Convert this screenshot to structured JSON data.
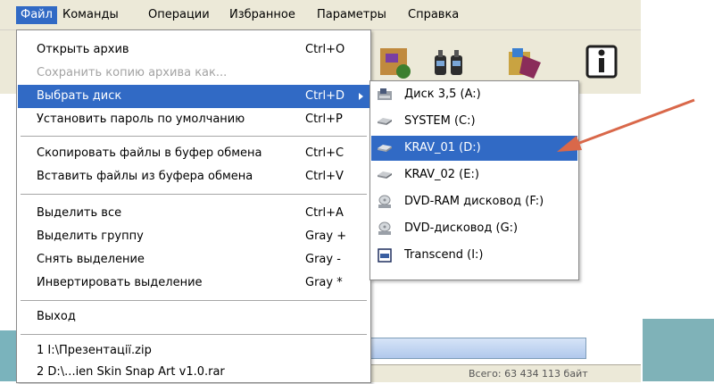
{
  "menubar": {
    "items": [
      {
        "label": "Файл"
      },
      {
        "label": "Команды"
      },
      {
        "label": "Операции"
      },
      {
        "label": "Избранное"
      },
      {
        "label": "Параметры"
      },
      {
        "label": "Справка"
      }
    ]
  },
  "file_menu": {
    "items": [
      {
        "label": "Открыть архив",
        "shortcut": "Ctrl+O"
      },
      {
        "label": "Сохранить копию архива как...",
        "shortcut": ""
      },
      {
        "label": "Выбрать диск",
        "shortcut": "Ctrl+D"
      },
      {
        "label": "Установить пароль по умолчанию",
        "shortcut": "Ctrl+P"
      },
      {
        "label": "Скопировать файлы в буфер обмена",
        "shortcut": "Ctrl+C"
      },
      {
        "label": "Вставить файлы из буфера обмена",
        "shortcut": "Ctrl+V"
      },
      {
        "label": "Выделить все",
        "shortcut": "Ctrl+A"
      },
      {
        "label": "Выделить группу",
        "shortcut": "Gray +"
      },
      {
        "label": "Снять выделение",
        "shortcut": "Gray -"
      },
      {
        "label": "Инвертировать выделение",
        "shortcut": "Gray *"
      },
      {
        "label": "Выход",
        "shortcut": ""
      },
      {
        "label": "1  I:\\Презентації.zip",
        "shortcut": ""
      },
      {
        "label": "2  D:\\...ien Skin Snap Art v1.0.rar",
        "shortcut": ""
      }
    ]
  },
  "drive_submenu": {
    "items": [
      {
        "label": "Диск 3,5 (A:)",
        "icon": "floppy-icon"
      },
      {
        "label": "SYSTEM (C:)",
        "icon": "hard-drive-icon"
      },
      {
        "label": "KRAV_01 (D:)",
        "icon": "hard-drive-icon"
      },
      {
        "label": "KRAV_02 (E:)",
        "icon": "hard-drive-icon"
      },
      {
        "label": "DVD-RAM дисковод (F:)",
        "icon": "optical-drive-icon"
      },
      {
        "label": "DVD-дисковод (G:)",
        "icon": "optical-drive-icon"
      },
      {
        "label": "Transcend (I:)",
        "icon": "removable-drive-icon"
      }
    ]
  },
  "status_bar": {
    "text": "Всего: 63 434 113 байт"
  },
  "colors": {
    "highlight": "#316ac5",
    "arrow": "#d9684a",
    "teal": "#7fb2b8"
  }
}
